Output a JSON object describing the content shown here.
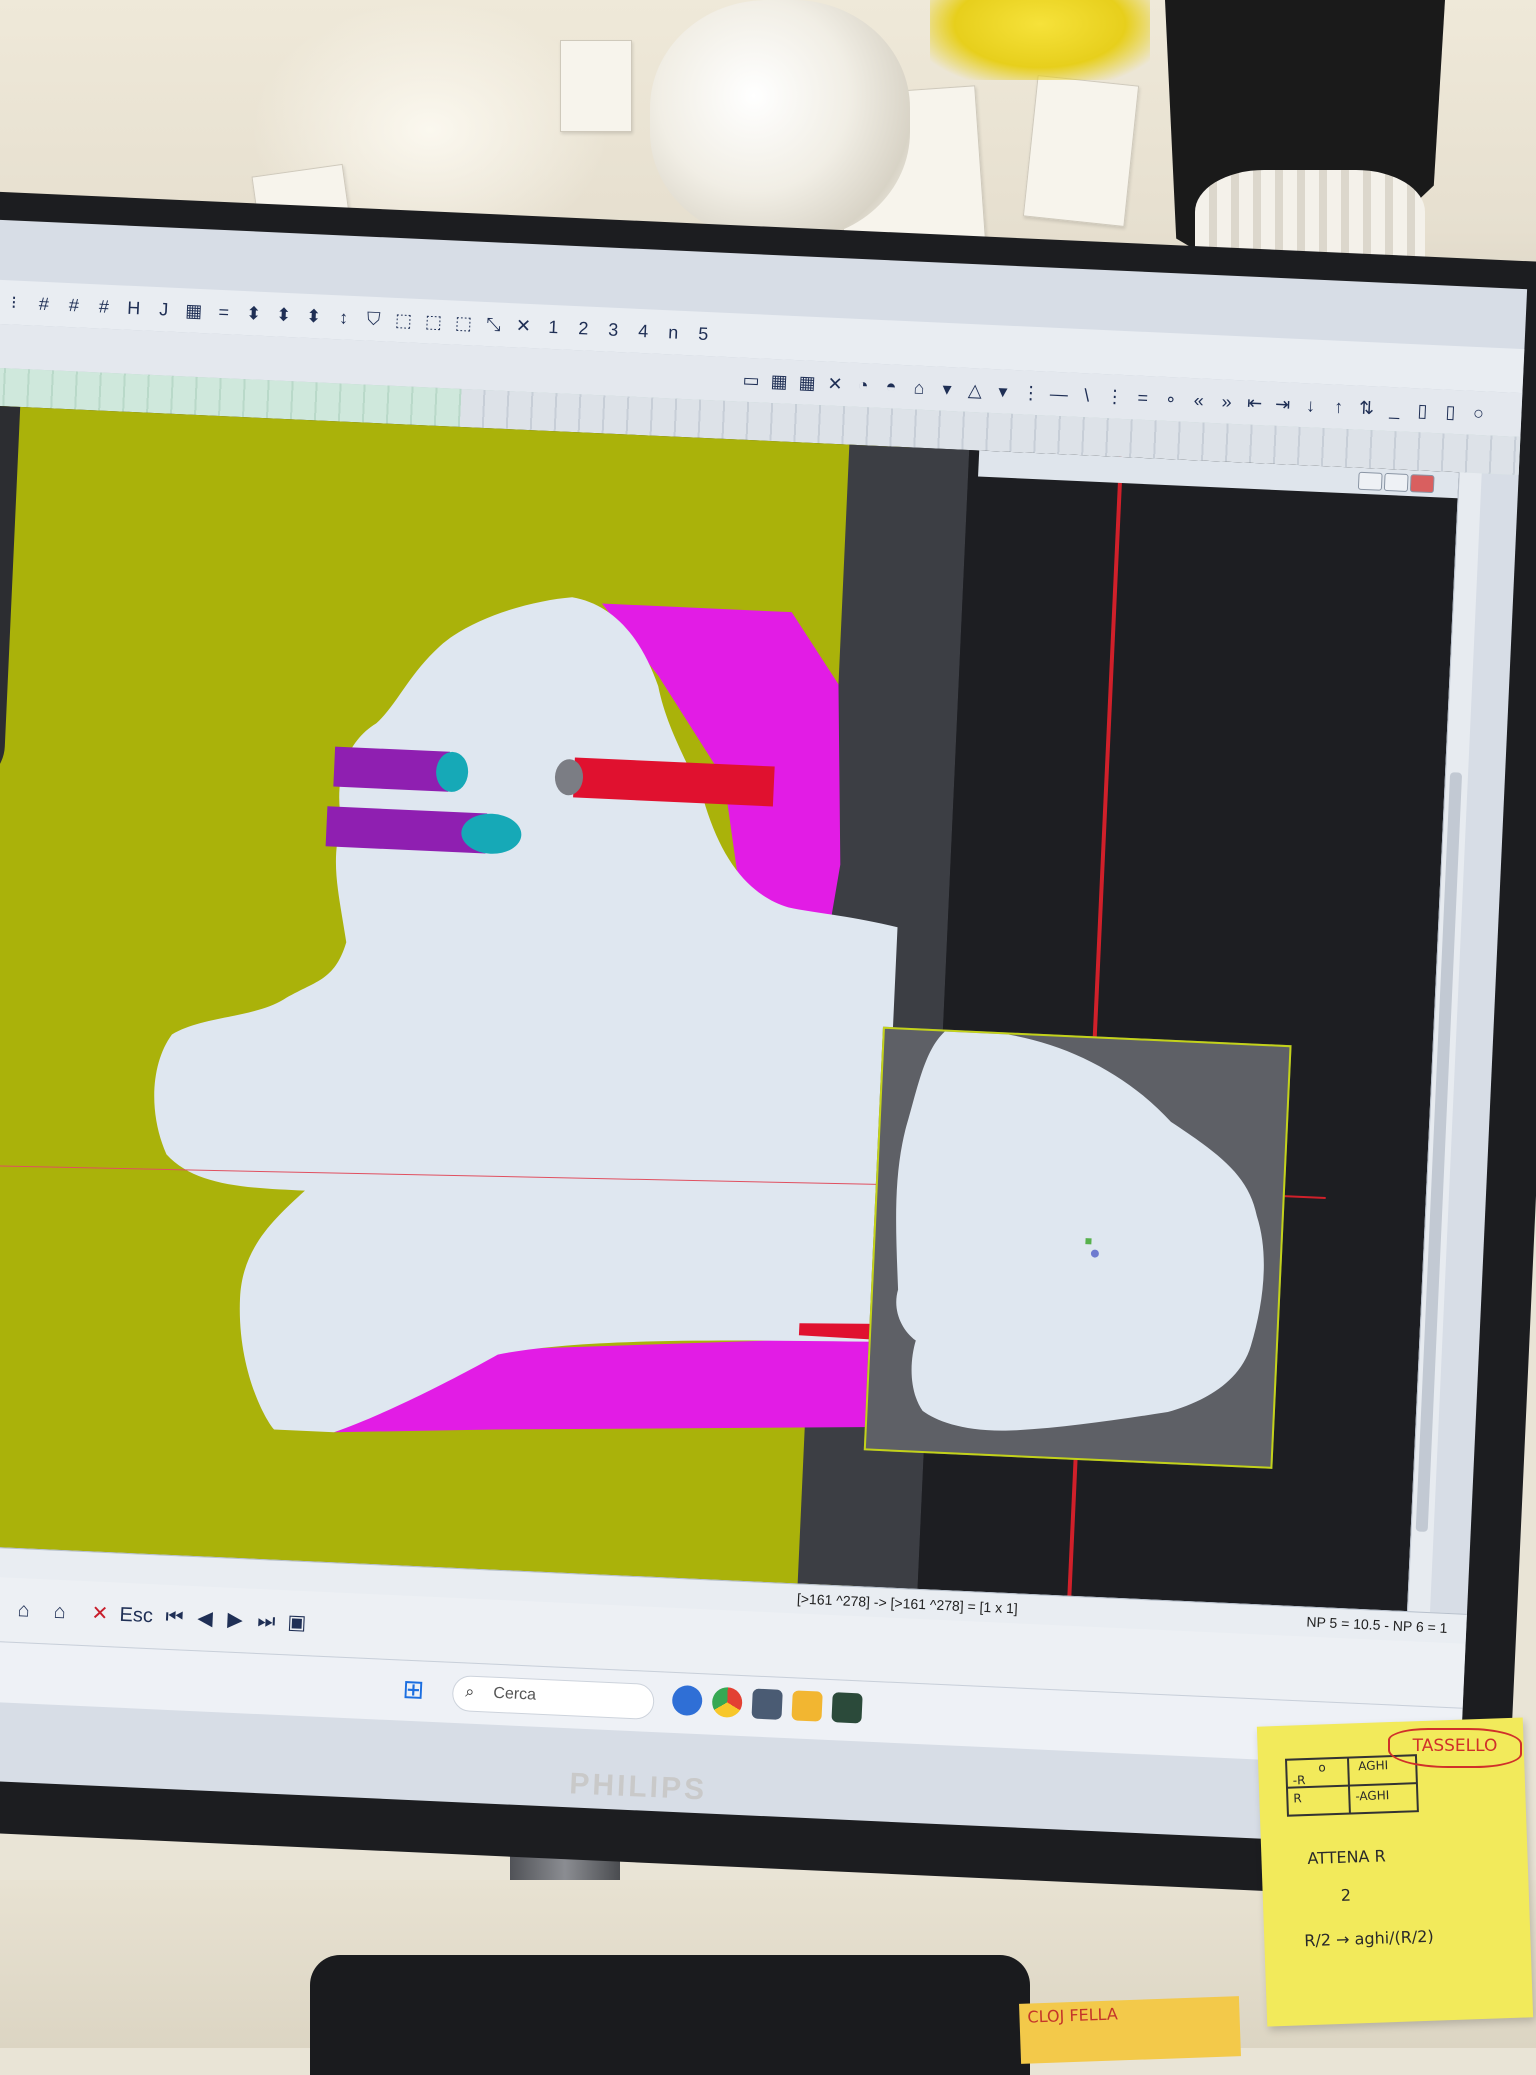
{
  "toolbar": {
    "row1": [
      "⁝",
      "#",
      "#",
      "#",
      "H",
      "J",
      "▦",
      "=",
      "⬍",
      "⬍",
      "⬍",
      "↕",
      "⛉",
      "⬚",
      "⬚",
      "⬚",
      "⤡",
      "✕",
      "1",
      "2",
      "3",
      "4",
      "n",
      "5"
    ],
    "row2_icons": [
      "▭",
      "▦",
      "▦",
      "✕",
      "◔",
      "◓",
      "⌂",
      "▾",
      "△",
      "▾",
      "⋮",
      "—",
      "\\",
      "⋮",
      "=",
      "∘",
      "«",
      "»",
      "⇤",
      "⇥",
      "↓",
      "↑",
      "⇅",
      "_",
      "▯",
      "▯",
      "○"
    ]
  },
  "status": {
    "coords": "[>161 ^278] -> [>161 ^278] = [1 x 1]",
    "np": "NP 5 = 10.5 - NP 6 = 1"
  },
  "bottom_toolbar": {
    "esc_label": "Esc"
  },
  "taskbar": {
    "search_placeholder": "Cerca"
  },
  "monitor": {
    "brand": "PHILIPS"
  },
  "sticky_note": {
    "label": "TASSELLO",
    "table": [
      "o",
      "AGHI",
      "-R",
      "R",
      "-AGHI"
    ],
    "line1": "ATTENA R",
    "line2": "2",
    "line3": "R/2 → aghi/(R/2)"
  },
  "orange_note": {
    "text": "CLOJ FELLA"
  },
  "colors": {
    "olive": "#aab20a",
    "magenta": "#e21ce5",
    "purple": "#8f1fb1",
    "cyan": "#16a9b7",
    "red": "#e0112f",
    "pale": "#dfe7f0"
  }
}
